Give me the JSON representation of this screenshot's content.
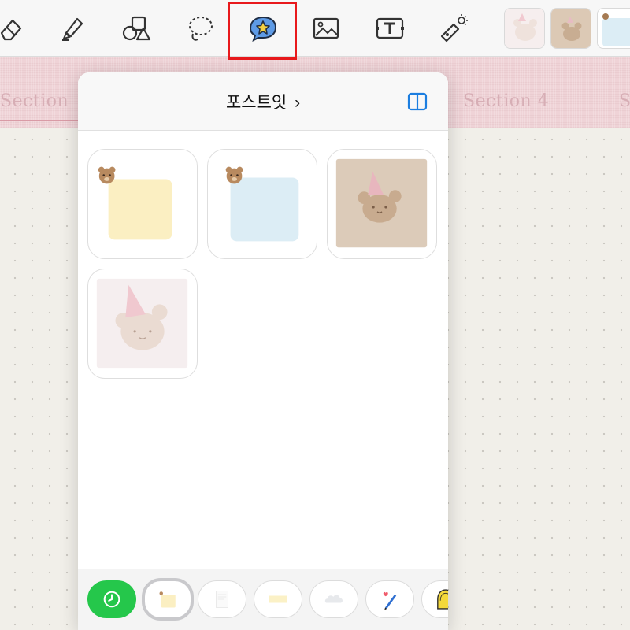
{
  "toolbar": {
    "tools": [
      {
        "name": "eraser-tool",
        "icon": "eraser-icon"
      },
      {
        "name": "highlighter-tool",
        "icon": "highlighter-icon"
      },
      {
        "name": "shapes-tool",
        "icon": "shapes-icon"
      },
      {
        "name": "lasso-tool",
        "icon": "lasso-icon"
      },
      {
        "name": "sticker-tool",
        "icon": "sticker-icon",
        "selected": true
      },
      {
        "name": "image-tool",
        "icon": "image-icon"
      },
      {
        "name": "text-tool",
        "icon": "text-icon"
      },
      {
        "name": "laser-pointer-tool",
        "icon": "laser-pointer-icon"
      }
    ],
    "recent_stickers": [
      "bear-pink-sticker",
      "bear-beige-sticker",
      "blue-note-sticker"
    ]
  },
  "sections": {
    "first_label": "Section",
    "section4_label": "Section 4",
    "section5_label": "S"
  },
  "popover": {
    "title": "포스트잇",
    "chevron": "›",
    "split_icon": "split-view-icon",
    "stickers": [
      {
        "name": "yellow-note-bear",
        "color": "#fbefc2"
      },
      {
        "name": "blue-note-bear",
        "color": "#dcedf5"
      },
      {
        "name": "bear-party-beige",
        "color": "#dccbb9"
      },
      {
        "name": "bear-party-pink",
        "color": "#f5eeef"
      }
    ],
    "categories": [
      {
        "name": "recent-category",
        "icon": "clock-icon"
      },
      {
        "name": "postit-category",
        "icon": "note-icon",
        "active": true
      },
      {
        "name": "paper-category",
        "icon": "paper-icon"
      },
      {
        "name": "tape-category",
        "icon": "tape-icon"
      },
      {
        "name": "cloud-category",
        "icon": "cloud-icon"
      },
      {
        "name": "pen-category",
        "icon": "pen-icon"
      },
      {
        "name": "badge-category",
        "icon": "badge-icon"
      }
    ]
  },
  "colors": {
    "accent_blue": "#1c7ee0",
    "selection_red": "#e8191c",
    "recent_green": "#25c74b",
    "section_pink": "#efd3d7"
  }
}
